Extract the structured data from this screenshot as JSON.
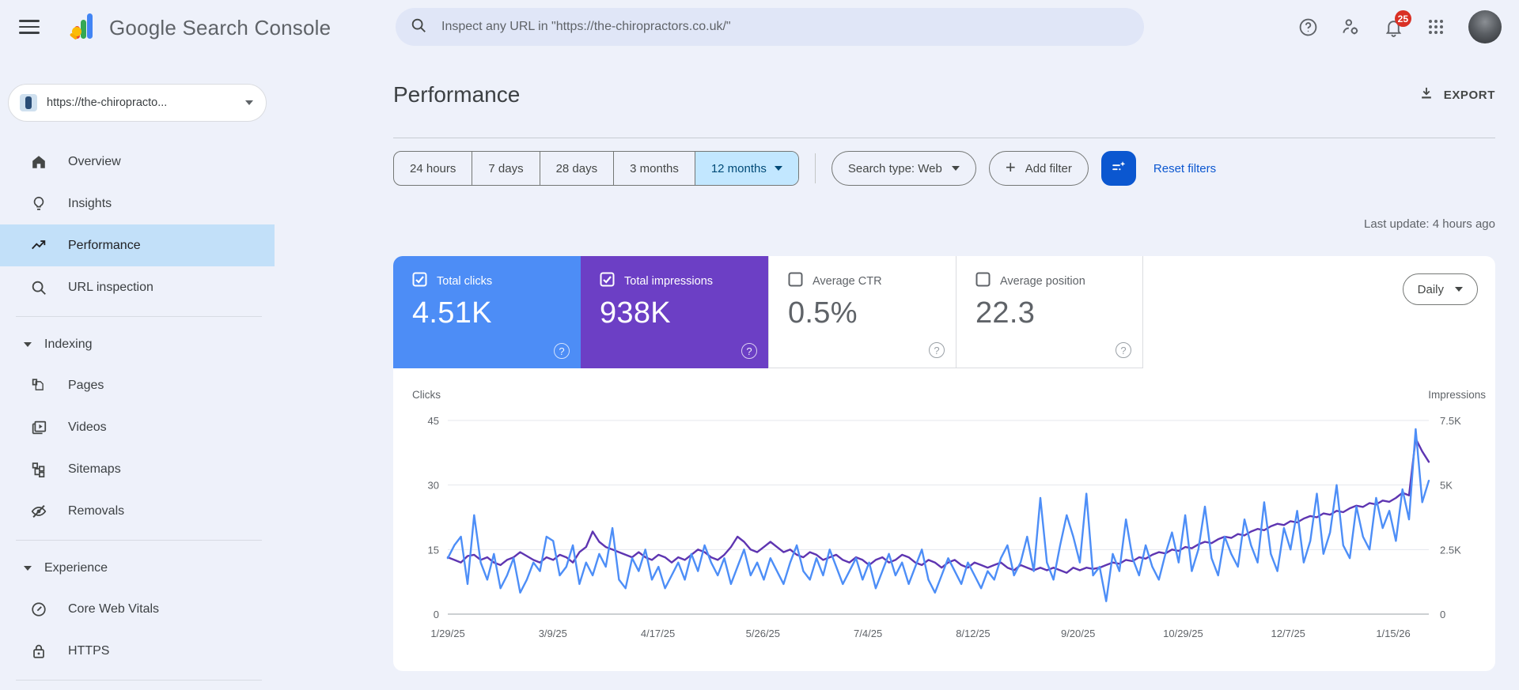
{
  "topbar": {
    "app_title": "Google Search Console",
    "search_placeholder": "Inspect any URL in \"https://the-chiropractors.co.uk/\"",
    "notifications_count": "25"
  },
  "icons": {
    "help": "?",
    "plus": "+"
  },
  "sidebar": {
    "property": {
      "label": "https://the-chiropracto..."
    },
    "items": [
      {
        "label": "Overview"
      },
      {
        "label": "Insights"
      },
      {
        "label": "Performance"
      },
      {
        "label": "URL inspection"
      }
    ],
    "sections": [
      {
        "label": "Indexing",
        "items": [
          {
            "label": "Pages"
          },
          {
            "label": "Videos"
          },
          {
            "label": "Sitemaps"
          },
          {
            "label": "Removals"
          }
        ]
      },
      {
        "label": "Experience",
        "items": [
          {
            "label": "Core Web Vitals"
          },
          {
            "label": "HTTPS"
          }
        ]
      }
    ]
  },
  "main": {
    "title": "Performance",
    "export_label": "EXPORT",
    "date_tabs": [
      "24 hours",
      "7 days",
      "28 days",
      "3 months",
      "12 months"
    ],
    "selected_tab": "12 months",
    "search_type_label": "Search type: Web",
    "add_filter_label": "Add filter",
    "reset_filters_label": "Reset filters",
    "last_update": "Last update: 4 hours ago",
    "interval_label": "Daily",
    "metrics": [
      {
        "label": "Total clicks",
        "value": "4.51K",
        "checked": true,
        "color": "#4d8df6"
      },
      {
        "label": "Total impressions",
        "value": "938K",
        "checked": true,
        "color": "#6c3fc5"
      },
      {
        "label": "Average CTR",
        "value": "0.5%",
        "checked": false,
        "color": "#ffffff"
      },
      {
        "label": "Average position",
        "value": "22.3",
        "checked": false,
        "color": "#ffffff"
      }
    ]
  },
  "chart_data": {
    "type": "line",
    "title": "Clicks and impressions over time (daily, 12 months)",
    "x_tick_labels": [
      "1/29/25",
      "3/9/25",
      "4/17/25",
      "5/26/25",
      "7/4/25",
      "8/12/25",
      "9/20/25",
      "10/29/25",
      "12/7/25",
      "1/15/26"
    ],
    "left_axis": {
      "label": "Clicks",
      "max": 45,
      "ticks": [
        0,
        15,
        30,
        45
      ],
      "tick_labels": [
        "0",
        "15",
        "30",
        "45"
      ]
    },
    "right_axis": {
      "label": "Impressions",
      "max": 7500,
      "ticks": [
        0,
        2500,
        5000,
        7500
      ],
      "tick_labels": [
        "0",
        "2.5K",
        "5K",
        "7.5K"
      ]
    },
    "grid": true,
    "legend": "none",
    "series": [
      {
        "name": "Clicks",
        "axis": "left",
        "color": "#4d8ef7",
        "values": [
          13,
          16,
          18,
          7,
          23,
          12,
          8,
          14,
          6,
          9,
          13,
          5,
          8,
          12,
          10,
          18,
          17,
          9,
          11,
          16,
          7,
          12,
          9,
          14,
          11,
          20,
          8,
          6,
          13,
          10,
          15,
          8,
          11,
          6,
          9,
          12,
          8,
          14,
          10,
          16,
          12,
          9,
          13,
          7,
          11,
          15,
          9,
          12,
          8,
          13,
          10,
          7,
          12,
          16,
          10,
          8,
          13,
          9,
          15,
          11,
          7,
          10,
          13,
          8,
          12,
          6,
          10,
          14,
          9,
          12,
          7,
          11,
          15,
          8,
          5,
          9,
          13,
          10,
          7,
          12,
          9,
          6,
          10,
          8,
          13,
          16,
          9,
          12,
          18,
          10,
          27,
          12,
          8,
          16,
          23,
          18,
          12,
          28,
          9,
          11,
          3,
          14,
          10,
          22,
          13,
          9,
          16,
          11,
          8,
          14,
          19,
          12,
          23,
          10,
          15,
          25,
          13,
          9,
          18,
          14,
          11,
          22,
          16,
          12,
          26,
          14,
          10,
          20,
          15,
          24,
          12,
          17,
          28,
          14,
          19,
          30,
          16,
          13,
          25,
          18,
          15,
          27,
          20,
          24,
          17,
          29,
          22,
          43,
          26,
          31
        ]
      },
      {
        "name": "Impressions",
        "axis": "right",
        "color": "#5e35b1",
        "values": [
          2200,
          2100,
          2000,
          2250,
          2300,
          2100,
          2200,
          2000,
          1900,
          2100,
          2200,
          2400,
          2250,
          2100,
          2000,
          2200,
          2100,
          2300,
          2200,
          2000,
          2400,
          2600,
          3200,
          2800,
          2600,
          2500,
          2400,
          2300,
          2200,
          2400,
          2200,
          2100,
          2300,
          2200,
          2000,
          2200,
          2100,
          2300,
          2500,
          2400,
          2200,
          2100,
          2300,
          2600,
          3000,
          2800,
          2500,
          2400,
          2600,
          2800,
          2600,
          2400,
          2500,
          2300,
          2200,
          2400,
          2300,
          2100,
          2200,
          2300,
          2100,
          2000,
          2200,
          2100,
          1900,
          2100,
          2200,
          2000,
          2100,
          2300,
          2200,
          2000,
          1900,
          2100,
          2000,
          1800,
          2000,
          2100,
          1900,
          1800,
          2000,
          1900,
          1800,
          1900,
          2000,
          1800,
          1700,
          1900,
          1800,
          1700,
          1800,
          1700,
          1800,
          1700,
          1600,
          1800,
          1700,
          1800,
          1750,
          1800,
          1900,
          2000,
          1950,
          2100,
          2050,
          2200,
          2150,
          2300,
          2400,
          2350,
          2500,
          2450,
          2600,
          2550,
          2700,
          2800,
          2750,
          2900,
          3000,
          2950,
          3100,
          3050,
          3200,
          3300,
          3250,
          3400,
          3500,
          3450,
          3600,
          3550,
          3700,
          3800,
          3750,
          3900,
          3850,
          4000,
          3950,
          4100,
          4200,
          4150,
          4300,
          4250,
          4400,
          4350,
          4500,
          4700,
          4600,
          6800,
          6300,
          5900
        ]
      }
    ]
  }
}
